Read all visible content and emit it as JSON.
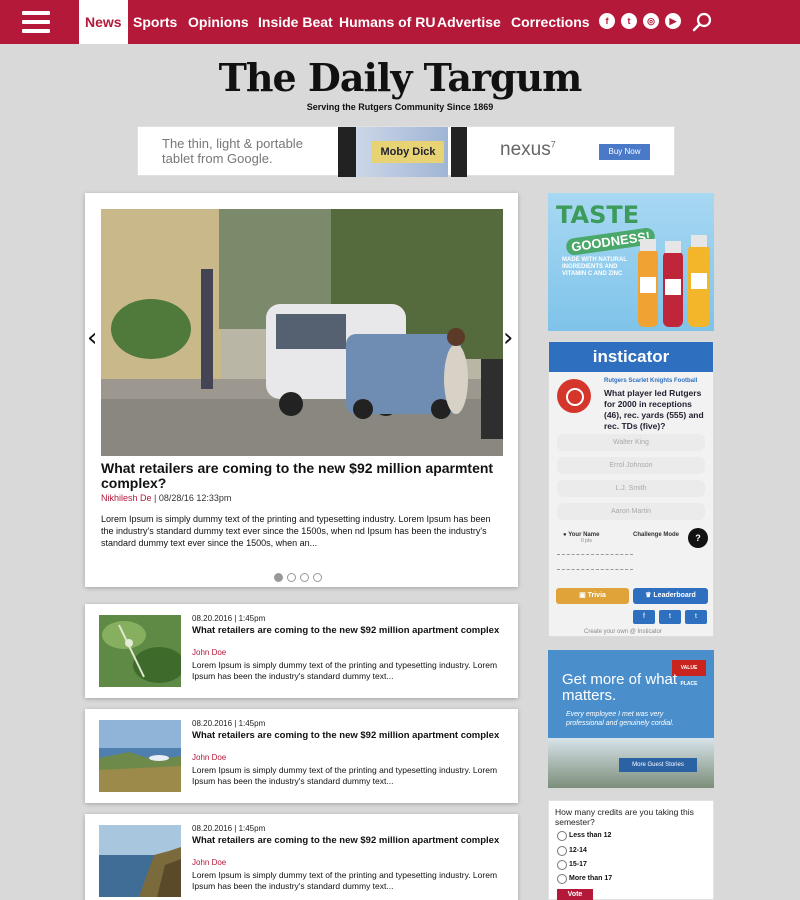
{
  "nav": {
    "items": [
      "News",
      "Sports",
      "Opinions",
      "Inside Beat",
      "Humans of RU",
      "Advertise",
      "Corrections"
    ],
    "active": "News",
    "accent_color": "#b5193a",
    "social_icons": [
      "facebook-icon",
      "twitter-icon",
      "instagram-icon",
      "youtube-icon"
    ]
  },
  "masthead": {
    "logo": "The Daily Targum",
    "tagline": "Serving the Rutgers Community Since 1869"
  },
  "banner_ad": {
    "text": "The thin, light & portable tablet from Google.",
    "book": "Moby Dick",
    "brand": "nexus",
    "brand_sup": "7",
    "cta": "Buy Now"
  },
  "featured": {
    "title": "What retailers are coming to the new $92 million aparmtent complex?",
    "author": "Nikhilesh De",
    "meta_sep": " | ",
    "datetime": "08/28/16 12:33pm",
    "body": "Lorem Ipsum is simply dummy text of the printing and typesetting industry. Lorem Ipsum has been the industry's standard dummy text ever since the 1500s, when nd Ipsum has been the industry's standard dummy text ever since the 1500s, when an...",
    "prev_arrow": "‹",
    "next_arrow": "›",
    "slides": 4,
    "active_slide": 1
  },
  "articles": [
    {
      "date": "08.20.2016 | 1:45pm",
      "title": "What retailers are coming to the new $92 million apartment complex",
      "author": "John Doe",
      "summary": "Lorem Ipsum is simply dummy text of the printing and typesetting industry. Lorem Ipsum has been the industry's standard dummy text..."
    },
    {
      "date": "08.20.2016 | 1:45pm",
      "title": "What retailers are coming to the new $92 million apartment complex",
      "author": "John Doe",
      "summary": "Lorem Ipsum is simply dummy text of the printing and typesetting industry. Lorem Ipsum has been the industry's standard dummy text..."
    },
    {
      "date": "08.20.2016 | 1:45pm",
      "title": "What retailers are coming to the new $92 million apartment complex",
      "author": "John Doe",
      "summary": "Lorem Ipsum is simply dummy text of the printing and typesetting industry. Lorem Ipsum has been the industry's standard dummy text..."
    }
  ],
  "ad_taste": {
    "line1": "TASTE",
    "line2": "GOODNESS!",
    "line3": "MADE WITH NATURAL INGREDIENTS AND VITAMIN C AND ZINC"
  },
  "insticator": {
    "brand": "insticator",
    "category": "Rutgers Scarlet Knights Football",
    "question": "What player led Rutgers for 2000 in receptions (46), rec. yards (555) and rec. TDs (five)?",
    "options": [
      "Walter King",
      "Errol Johnson",
      "L.J. Smith",
      "Aaron Martin"
    ],
    "your_name": "Your Name",
    "points": "0 pts",
    "challenge": "Challenge Mode",
    "help": "?",
    "trivia": "Trivia",
    "leaderboard": "Leaderboard",
    "social": [
      "f",
      "t",
      "t"
    ],
    "create": "Create your own @ Insticator"
  },
  "ad_value": {
    "headline": "Get more of what matters.",
    "quote": "Every employee I met was very professional and genuinely cordial.",
    "cta": "More Guest Stories",
    "logo": "VALUE PLACE"
  },
  "poll": {
    "question": "How many credits are you taking this semester?",
    "options": [
      "Less than 12",
      "12-14",
      "15-17",
      "More than 17"
    ],
    "vote": "Vote"
  }
}
